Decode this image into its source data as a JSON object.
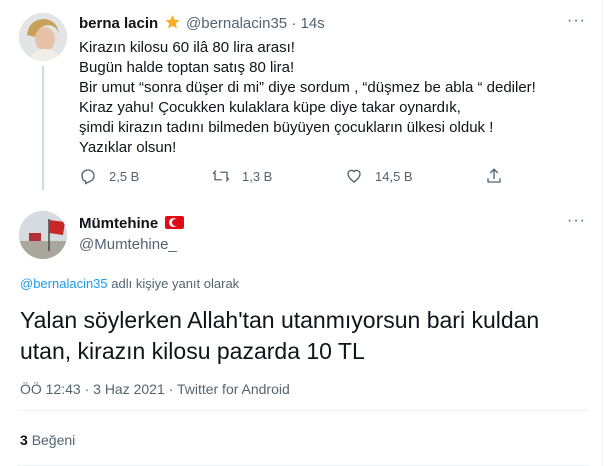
{
  "colors": {
    "accent": "#1d9bf0",
    "text": "#0f1419",
    "muted": "#536471",
    "verified": "#ffad1f",
    "flag": "#e30a17"
  },
  "tweet": {
    "author_name": "berna lacin",
    "handle": "@bernalacin35",
    "separator": "·",
    "time": "14s",
    "badge_icon": "verified-badge-icon",
    "text": "Kirazın kilosu 60 ilâ 80 lira arası!\nBugün halde toptan satış 80 lira!\nBir umut “sonra düşer di mi” diye sordum , “düşmez be abla “ dediler!\nKiraz yahu! Çocukken kulaklara küpe diye takar oynardık,\nşimdi kirazın tadını bilmeden büyüyen çocukların ülkesi olduk !\nYazıklar olsun!",
    "replies": "2,5 B",
    "retweets": "1,3 B",
    "likes": "14,5 B"
  },
  "reply": {
    "author_name": "Mümtehine",
    "handle": "@Mumtehine_",
    "flag_icon": "turkish-flag-icon",
    "replying_to_handle": "@bernalacin35",
    "replying_to_suffix": "adlı kişiye yanıt olarak",
    "text": "Yalan söylerken Allah'tan utanmıyorsun bari kuldan utan, kirazın kilosu pazarda 10 TL",
    "meta": "ÖÖ 12:43 · 3 Haz 2021 · Twitter for Android",
    "likes_count": "3",
    "likes_label": "Beğeni"
  },
  "more_icon": "···"
}
